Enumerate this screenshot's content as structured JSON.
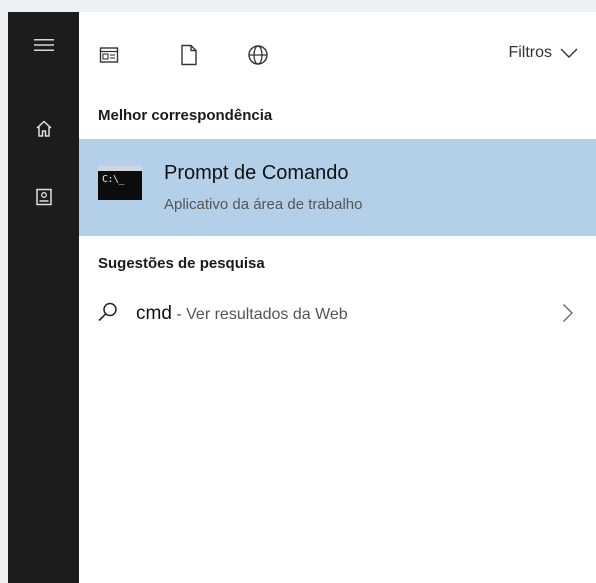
{
  "rail": {
    "items": [
      {
        "icon": "hamburger-menu-icon"
      },
      {
        "icon": "home-icon"
      },
      {
        "icon": "notebook-icon"
      }
    ]
  },
  "toolbar": {
    "icons": [
      "apps-icon",
      "documents-icon",
      "web-globe-icon"
    ],
    "filters_label": "Filtros"
  },
  "best_match": {
    "heading": "Melhor correspondência",
    "title": "Prompt de Comando",
    "subtitle": "Aplicativo da área de trabalho",
    "icon_text": "C:\\_"
  },
  "suggestions": {
    "heading": "Sugestões de pesquisa",
    "items": [
      {
        "query": "cmd",
        "suffix": " - Ver resultados da Web"
      }
    ]
  },
  "colors": {
    "rail": "#1c1c1c",
    "highlight": "#b4d0e8",
    "panel": "#ffffff"
  }
}
